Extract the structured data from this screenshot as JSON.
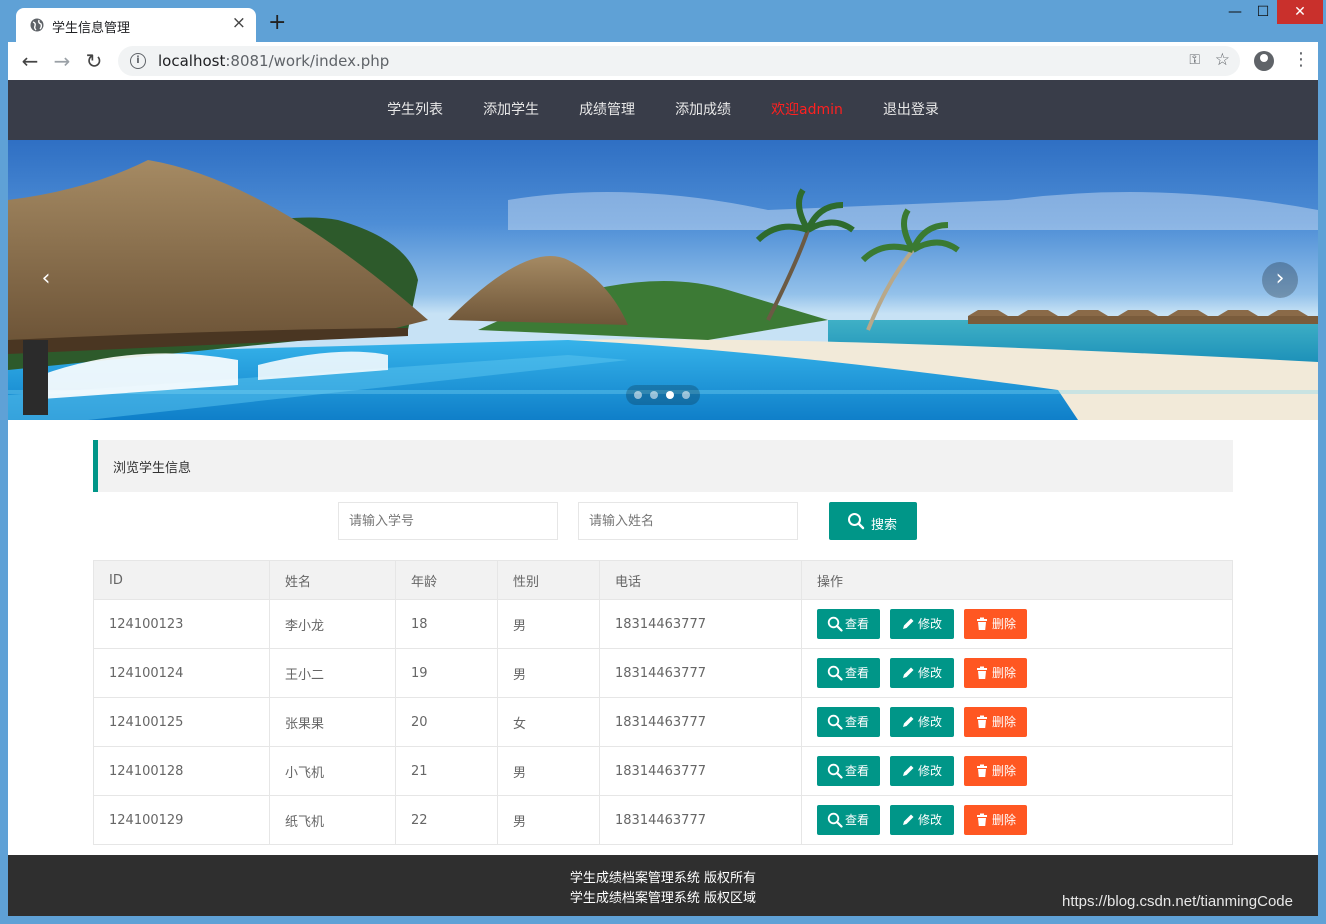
{
  "browser": {
    "tab_title": "学生信息管理",
    "url_host": "localhost",
    "url_rest": ":8081/work/index.php",
    "icons": [
      "globe-icon",
      "close-icon",
      "plus-icon",
      "back-icon",
      "forward-icon",
      "reload-icon",
      "info-icon",
      "key-icon",
      "star-icon",
      "profile-icon",
      "menu-icon"
    ]
  },
  "nav": {
    "items": [
      "学生列表",
      "添加学生",
      "成绩管理",
      "添加成绩"
    ],
    "welcome": "欢迎admin",
    "logout": "退出登录",
    "welcome_color": "#ff2020",
    "background": "#393d49"
  },
  "carousel": {
    "slide_count": 4,
    "active_index": 2
  },
  "section": {
    "title": "浏览学生信息",
    "accent": "#009688"
  },
  "search": {
    "id_placeholder": "请输入学号",
    "name_placeholder": "请输入姓名",
    "button": "搜索"
  },
  "table": {
    "headers": [
      "ID",
      "姓名",
      "年龄",
      "性别",
      "电话",
      "操作"
    ],
    "rows": [
      {
        "id": "124100123",
        "name": "李小龙",
        "age": "18",
        "sex": "男",
        "phone": "18314463777"
      },
      {
        "id": "124100124",
        "name": "王小二",
        "age": "19",
        "sex": "男",
        "phone": "18314463777"
      },
      {
        "id": "124100125",
        "name": "张果果",
        "age": "20",
        "sex": "女",
        "phone": "18314463777"
      },
      {
        "id": "124100128",
        "name": "小飞机",
        "age": "21",
        "sex": "男",
        "phone": "18314463777"
      },
      {
        "id": "124100129",
        "name": "纸飞机",
        "age": "22",
        "sex": "男",
        "phone": "18314463777"
      }
    ],
    "actions": {
      "view": "查看",
      "edit": "修改",
      "delete": "删除"
    },
    "action_colors": {
      "primary": "#009688",
      "danger": "#ff5722"
    }
  },
  "footer": {
    "line1": "学生成绩档案管理系统 版权所有",
    "line2": "学生成绩档案管理系统 版权区域"
  },
  "watermark": "https://blog.csdn.net/tianmingCode"
}
